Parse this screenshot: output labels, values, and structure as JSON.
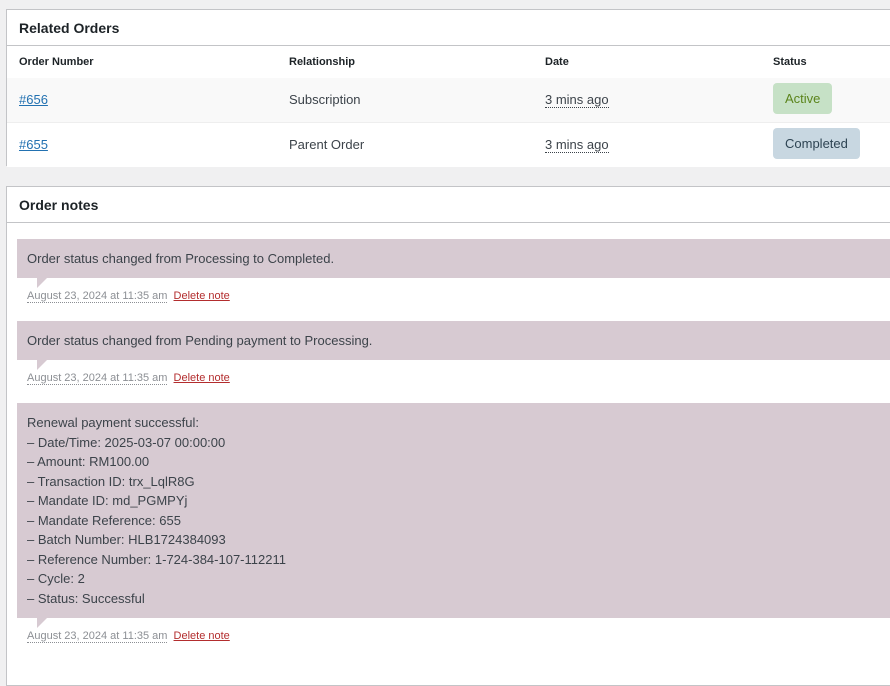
{
  "related_orders": {
    "title": "Related Orders",
    "headers": [
      "Order Number",
      "Relationship",
      "Date",
      "Status"
    ],
    "rows": [
      {
        "number": "#656",
        "relationship": "Subscription",
        "date": "3 mins ago",
        "status": "Active"
      },
      {
        "number": "#655",
        "relationship": "Parent Order",
        "date": "3 mins ago",
        "status": "Completed"
      }
    ],
    "colors": {
      "active_bg": "#c6e1c6",
      "active_text": "#5b841b",
      "completed_bg": "#c8d7e1",
      "completed_text": "#2e4453",
      "link": "#2271b1"
    }
  },
  "order_notes": {
    "title": "Order notes",
    "delete_label": "Delete note",
    "note_bg": "#d7cad2",
    "notes": [
      {
        "lines": [
          "Order status changed from Processing to Completed."
        ],
        "date": "August 23, 2024 at 11:35 am"
      },
      {
        "lines": [
          "Order status changed from Pending payment to Processing."
        ],
        "date": "August 23, 2024 at 11:35 am"
      },
      {
        "lines": [
          "Renewal payment successful:",
          "– Date/Time: 2025-03-07 00:00:00",
          "– Amount: RM100.00",
          "– Transaction ID: trx_LqlR8G",
          "– Mandate ID: md_PGMPYj",
          "– Mandate Reference: 655",
          "– Batch Number: HLB1724384093",
          "– Reference Number: 1-724-384-107-112211",
          "– Cycle: 2",
          "– Status: Successful"
        ],
        "date": "August 23, 2024 at 11:35 am"
      }
    ]
  }
}
